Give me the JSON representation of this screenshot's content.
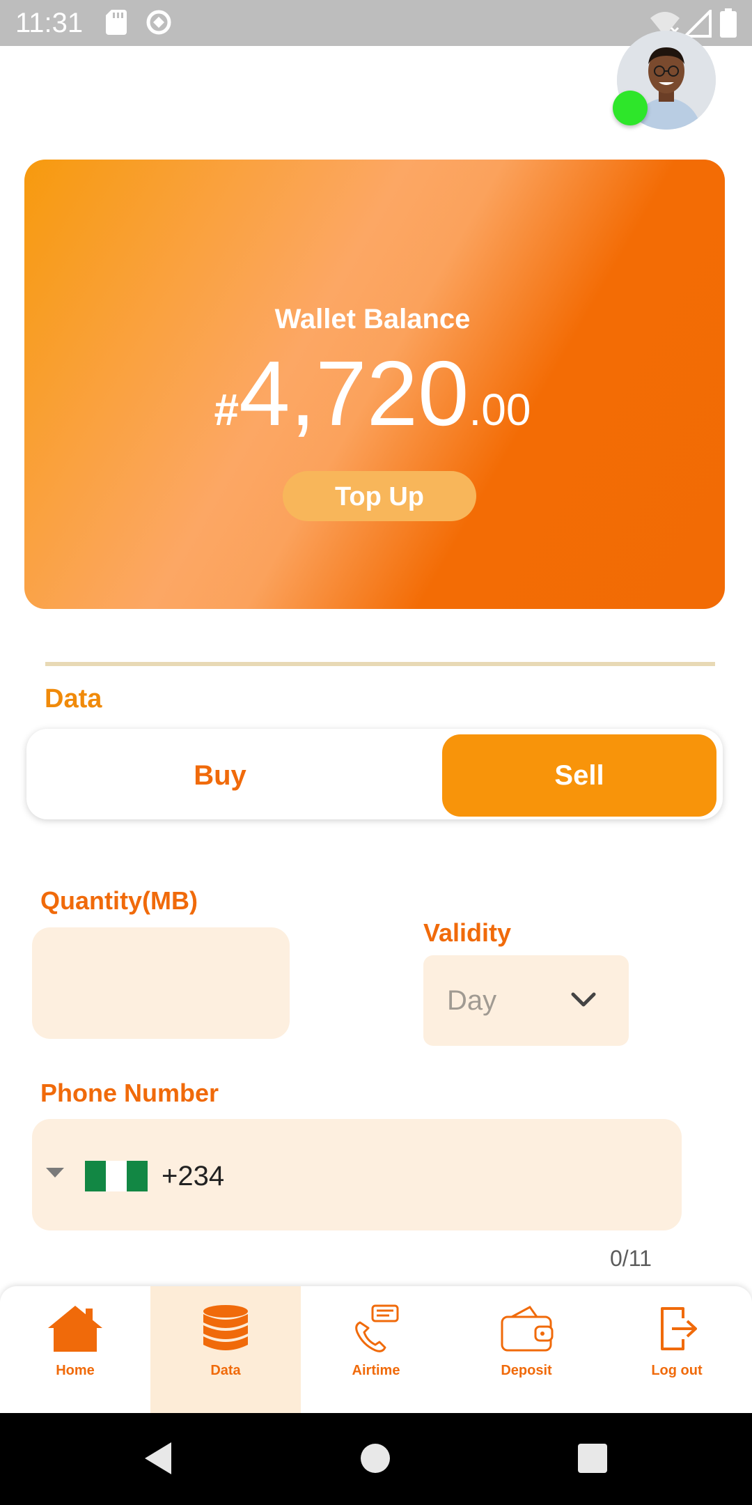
{
  "status_bar": {
    "time": "11:31",
    "icons": [
      "sd-card-icon",
      "rotate-icon",
      "wifi-off-icon",
      "signal-icon",
      "battery-icon"
    ]
  },
  "profile": {
    "avatar": "avatar",
    "online": true,
    "online_color": "#2ee62a"
  },
  "wallet": {
    "label": "Wallet Balance",
    "currency": "#",
    "amount_main": "4,720",
    "amount_decimals": ".00",
    "topup_label": "Top Up"
  },
  "section": {
    "title": "Data"
  },
  "segment": {
    "buy_label": "Buy",
    "sell_label": "Sell",
    "selected": "Sell"
  },
  "form": {
    "quantity_label": "Quantity(MB)",
    "quantity_value": "",
    "validity_label": "Validity",
    "validity_value": "Day",
    "phone_label": "Phone Number",
    "country_code": "+234",
    "country_flag": "nigeria-flag",
    "counter": "0/11"
  },
  "bottom_nav": {
    "active": "Data",
    "items": [
      {
        "label": "Home",
        "icon": "home-icon"
      },
      {
        "label": "Data",
        "icon": "database-icon"
      },
      {
        "label": "Airtime",
        "icon": "phone-call-icon"
      },
      {
        "label": "Deposit",
        "icon": "wallet-icon"
      },
      {
        "label": "Log out",
        "icon": "logout-icon"
      }
    ]
  },
  "colors": {
    "accent": "#f8940a",
    "accent_dark": "#f06a0a",
    "input_bg": "#fdefdf",
    "divider": "#e8d9b5"
  }
}
